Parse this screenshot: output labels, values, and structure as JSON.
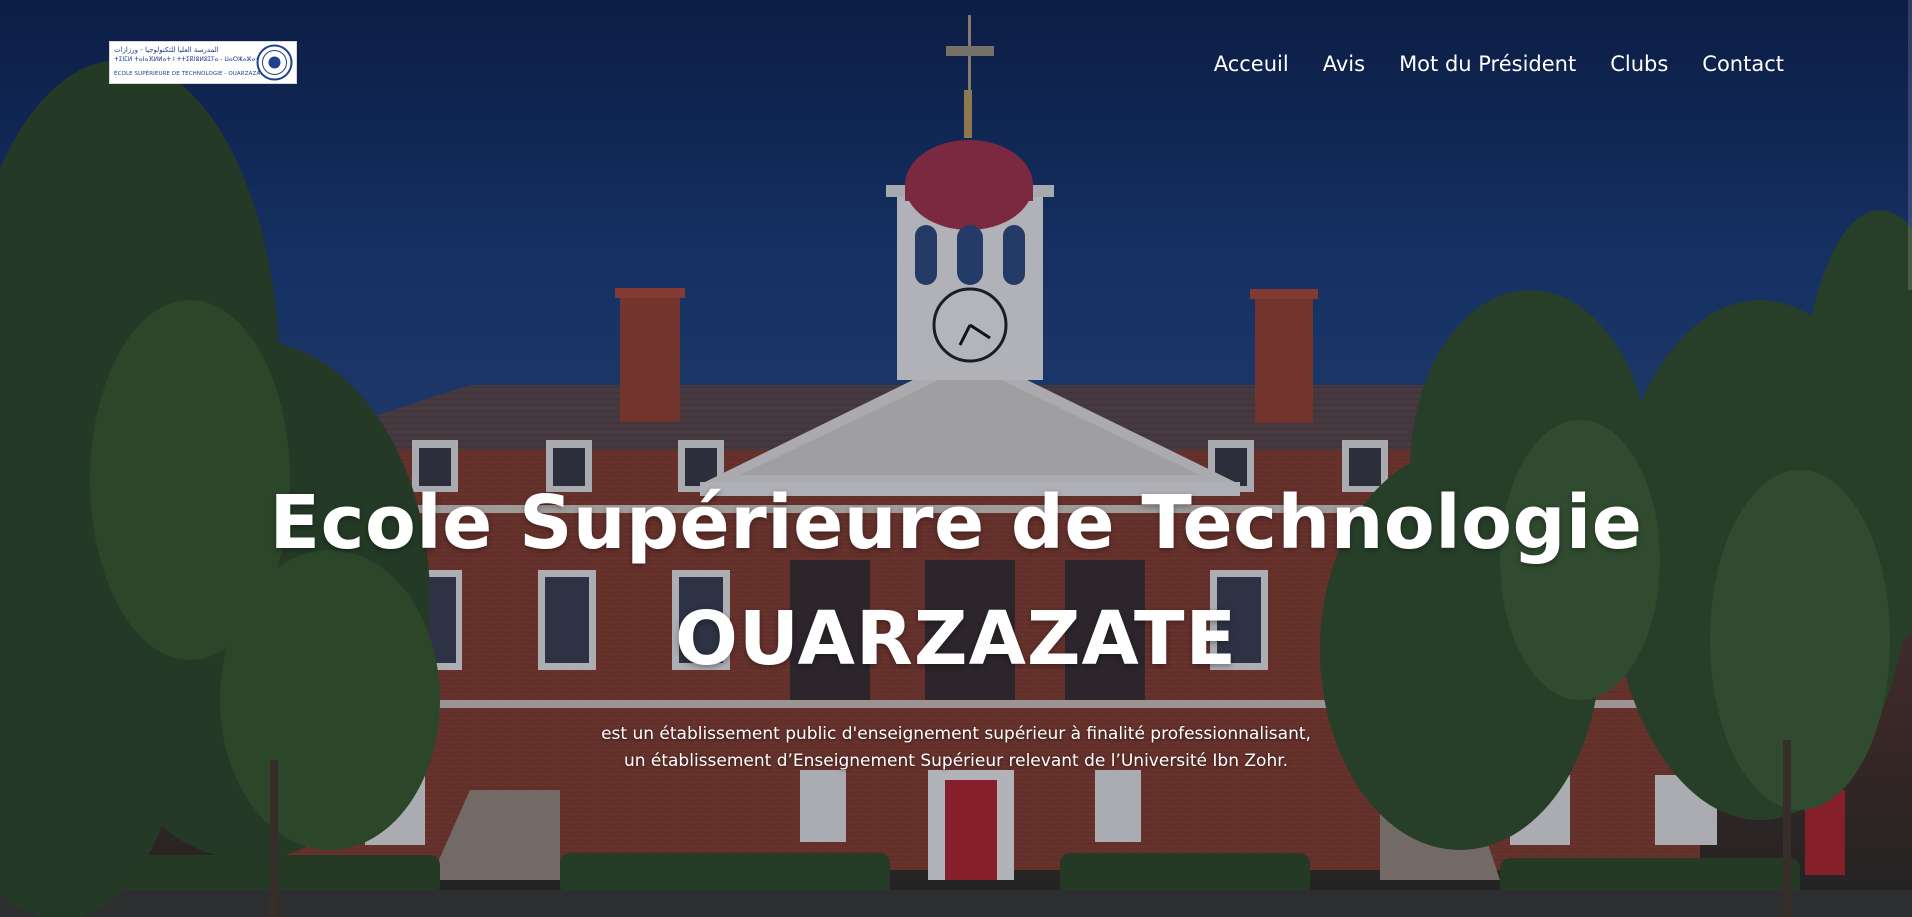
{
  "logo": {
    "arabic_line": "المدرسة العليا للتكنولوجيا - ورزازات",
    "tifinagh_line": "ⵜⵉⵏⵎⵍ ⵜⴰⵏⴰⴼⵍⵍⴰⵜ ⵏ ⵜⵜⵉⴽⵏⵓⵍⵓⵊⵢⴰ - ⵡⴰⵔⵣⴰⵣⴰⵜ",
    "french_line": "ÉCOLE SUPÉRIEURE DE TECHNOLOGIE - OUARZAZATE"
  },
  "nav": {
    "items": [
      {
        "label": "Acceuil"
      },
      {
        "label": "Avis"
      },
      {
        "label": "Mot du Président"
      },
      {
        "label": "Clubs"
      },
      {
        "label": "Contact"
      }
    ]
  },
  "hero": {
    "title_line1": "Ecole Supérieure de Technologie",
    "title_line2": "OUARZAZATE",
    "subtitle_line1": "est un établissement public d'enseignement supérieur à finalité professionnalisant,",
    "subtitle_line2": "un établissement d’Enseignement Supérieur relevant de l’Université Ibn Zohr."
  },
  "colors": {
    "sky": "#10295a",
    "brick": "#8a3e2e",
    "dome": "#a8344a",
    "text": "#ffffff"
  }
}
